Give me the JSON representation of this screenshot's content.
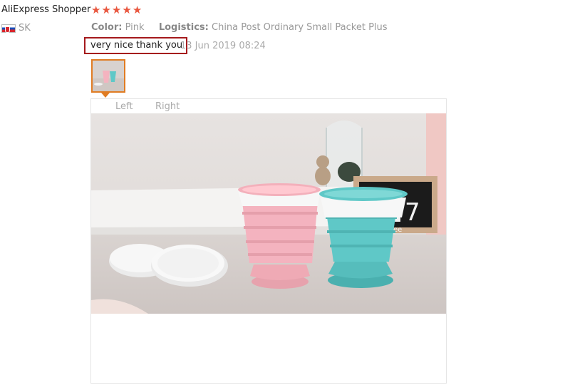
{
  "review": {
    "reviewer_name": "AliExpress Shopper",
    "rating": 5,
    "stars": [
      "★",
      "★",
      "★",
      "★",
      "★"
    ],
    "country_code": "SK",
    "flag_icon": "slovakia-flag-icon",
    "attributes": {
      "color_label": "Color:",
      "color_value": "Pink",
      "logistics_label": "Logistics:",
      "logistics_value": "China Post Ordinary Small Packet Plus"
    },
    "text": "very nice thank you",
    "date": "13 Jun 2019 08:24"
  },
  "viewer": {
    "left_label": "Left",
    "right_label": "Right",
    "photo_clock_digits": "7",
    "photo_base_text": "ee"
  },
  "colors": {
    "star": "#e9573f",
    "highlight_border": "#a5191c",
    "thumb_border": "#e07c23",
    "cup_pink": "#f4b3bf",
    "cup_teal": "#5fc8c7"
  }
}
